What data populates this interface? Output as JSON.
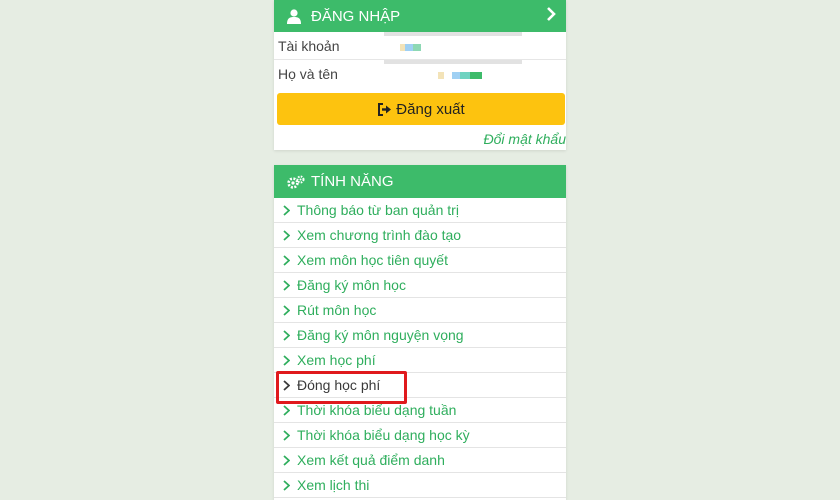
{
  "login": {
    "title": "ĐĂNG NHẬP",
    "account_label": "Tài khoản",
    "fullname_label": "Họ và tên",
    "logout_label": "Đăng xuất",
    "change_password": "Đổi mật khẩu"
  },
  "features": {
    "title": "TÍNH NĂNG",
    "items": [
      "Thông báo từ ban quản trị",
      "Xem chương trình đào tạo",
      "Xem môn học tiên quyết",
      "Đăng ký môn học",
      "Rút môn học",
      "Đăng ký môn nguyện vọng",
      "Xem học phí",
      "Đóng học phí",
      "Thời khóa biểu dạng tuần",
      "Thời khóa biểu dạng học kỳ",
      "Xem kết quả điểm danh",
      "Xem lịch thi"
    ],
    "highlighted_index": 7
  },
  "icons": {
    "login_header": "user-icon",
    "login_expand": "chevron-right-icon",
    "logout": "sign-out-icon",
    "features_header": "gears-icon",
    "menu_item": "chevron-right-icon"
  },
  "colors": {
    "header_green": "#3dbb6a",
    "link_green": "#2fae5d",
    "logout_yellow": "#fdc30f",
    "highlight_red": "#e0191d",
    "background": "#e6ede3"
  }
}
